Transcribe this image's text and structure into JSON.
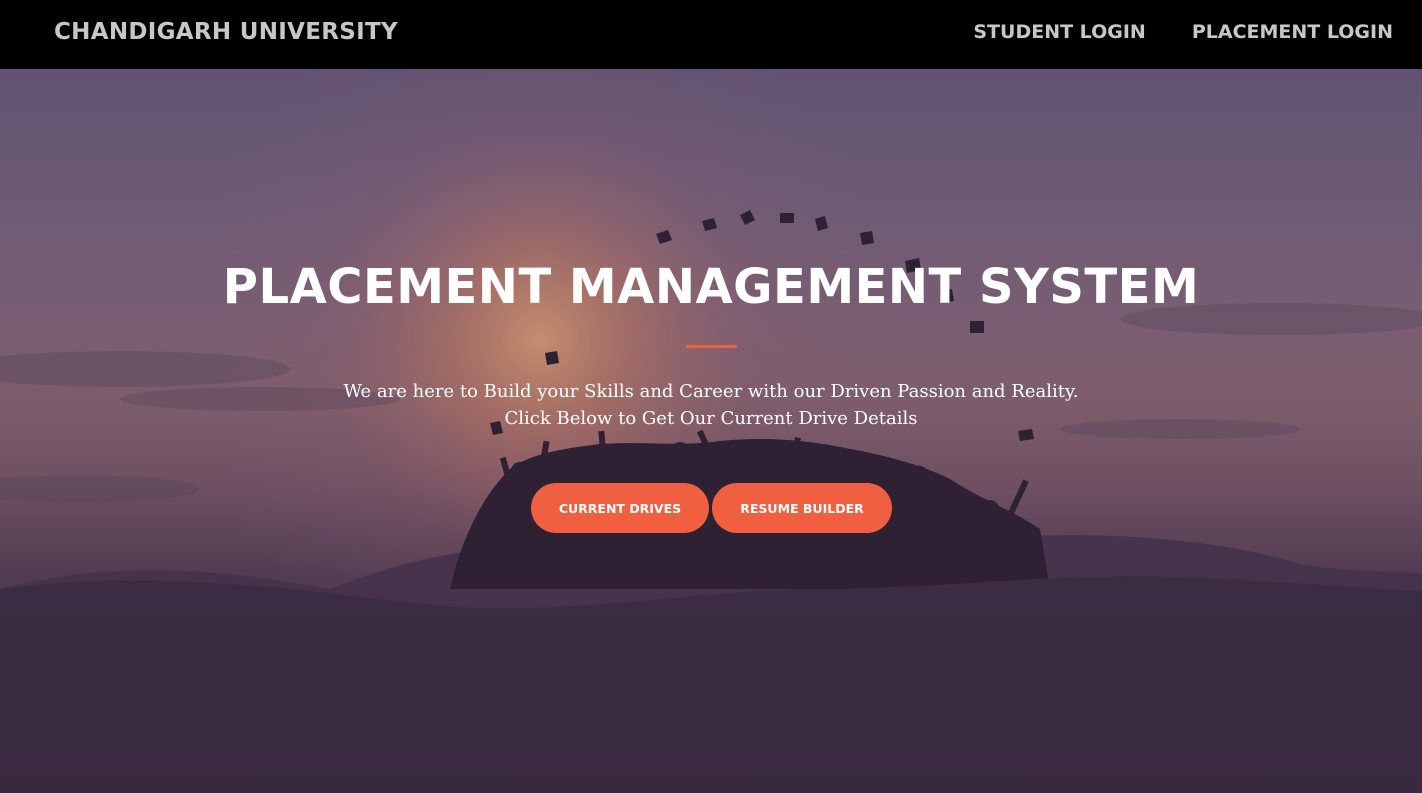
{
  "navbar": {
    "brand": "CHANDIGARH UNIVERSITY",
    "links": [
      {
        "label": "STUDENT LOGIN"
      },
      {
        "label": "PLACEMENT LOGIN"
      }
    ]
  },
  "hero": {
    "title": "PLACEMENT MANAGEMENT SYSTEM",
    "subtitle_line1": "We are here to Build your Skills and Career with our Driven Passion and Reality.",
    "subtitle_line2": "Click Below to Get Our Current Drive Details",
    "buttons": [
      {
        "label": "CURRENT DRIVES"
      },
      {
        "label": "RESUME BUILDER"
      }
    ]
  },
  "colors": {
    "navbar_bg": "#000000",
    "nav_text": "#c7c7c7",
    "accent": "#f05f40",
    "hero_text": "#ffffff"
  }
}
